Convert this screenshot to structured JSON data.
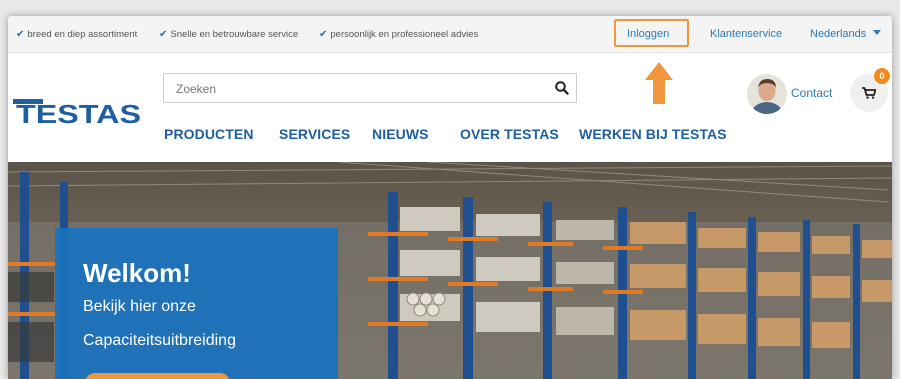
{
  "topbar": {
    "usps": [
      "breed en diep assortiment",
      "Snelle en betrouwbare service",
      "persoonlijk en professioneel advies"
    ],
    "login": "Inloggen",
    "customer_service": "Klantenservice",
    "language": "Nederlands"
  },
  "header": {
    "logo_text": "TESTAS",
    "search_placeholder": "Zoeken",
    "contact": "Contact",
    "cart_count": "0"
  },
  "nav": [
    "PRODUCTEN",
    "SERVICES",
    "NIEUWS",
    "OVER TESTAS",
    "WERKEN BIJ TESTAS"
  ],
  "hero": {
    "title": "Welkom!",
    "line1": "Bekijk hier onze",
    "line2": "Capaciteitsuitbreiding"
  },
  "colors": {
    "brand_blue": "#1f5fa0",
    "link_blue": "#2a7ab8",
    "accent_orange": "#f0963d",
    "panel_blue": "#1a72be"
  }
}
